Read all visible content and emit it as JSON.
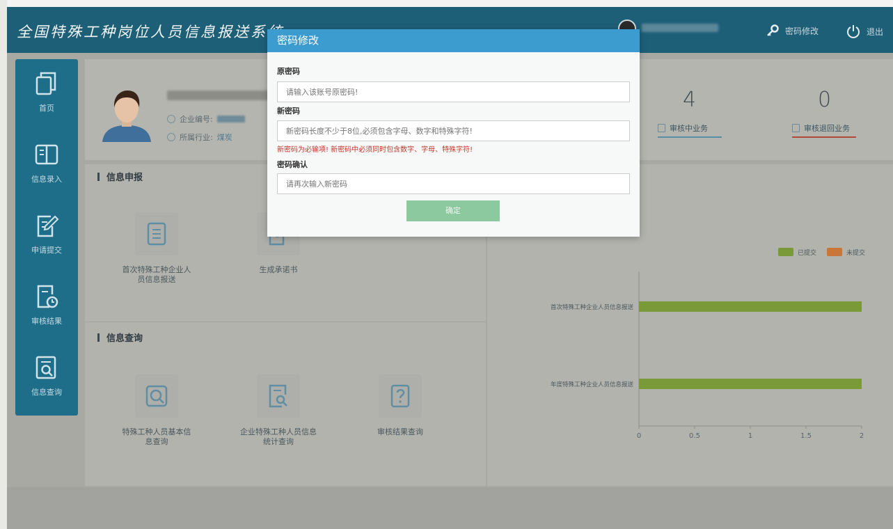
{
  "header": {
    "app_title": "全国特殊工种岗位人员信息报送系统",
    "change_password": "密码修改",
    "logout": "退出"
  },
  "sidebar": {
    "items": [
      {
        "label": "首页",
        "icon": "copy-icon"
      },
      {
        "label": "信息录入",
        "icon": "book-icon"
      },
      {
        "label": "申请提交",
        "icon": "edit-icon"
      },
      {
        "label": "审核结果",
        "icon": "clock-doc-icon"
      },
      {
        "label": "信息查询",
        "icon": "search-doc-icon"
      }
    ]
  },
  "profile": {
    "company_code_label": "企业编号:",
    "industry_label": "所属行业:",
    "industry_value": "煤炭"
  },
  "stats": [
    {
      "value": "4",
      "label": "审核中业务"
    },
    {
      "value": "0",
      "label": "审核退回业务"
    }
  ],
  "sections": {
    "report_title": "信息申报",
    "query_title": "信息查询",
    "report_tiles": [
      {
        "label": "首次特殊工种企业人员信息报送"
      },
      {
        "label": "生成承诺书"
      }
    ],
    "query_tiles": [
      {
        "label": "特殊工种人员基本信息查询"
      },
      {
        "label": "企业特殊工种人员信息统计查询"
      },
      {
        "label": "审核结果查询"
      }
    ]
  },
  "chart_data": {
    "type": "bar",
    "orientation": "horizontal",
    "categories": [
      "首次特殊工种企业人员信息报送",
      "年度特殊工种企业人员信息报送"
    ],
    "series": [
      {
        "name": "已提交",
        "values": [
          2,
          2
        ],
        "color": "#7a9a3a"
      },
      {
        "name": "未提交",
        "values": [
          0,
          0
        ],
        "color": "#c8763a"
      }
    ],
    "xlim": [
      0,
      2
    ],
    "xticks": [
      "0",
      "0.5",
      "1",
      "1.5",
      "2"
    ],
    "legend": "top-right"
  },
  "modal": {
    "title": "密码修改",
    "old_label": "原密码",
    "old_placeholder": "请输入该账号原密码!",
    "new_label": "新密码",
    "new_placeholder": "新密码长度不少于8位,必须包含字母、数字和特殊字符!",
    "error": "新密码为必输项!  新密码中必须同时包含数字、字母、特殊字符!",
    "confirm_label": "密码确认",
    "confirm_placeholder": "请再次输入新密码",
    "ok": "确定"
  },
  "colors": {
    "topbar": "#1e5f78",
    "sidebar": "#1e6e8a",
    "modal_header": "#3d9ccf",
    "ok_button": "#8cc99f",
    "error": "#c0392b"
  }
}
